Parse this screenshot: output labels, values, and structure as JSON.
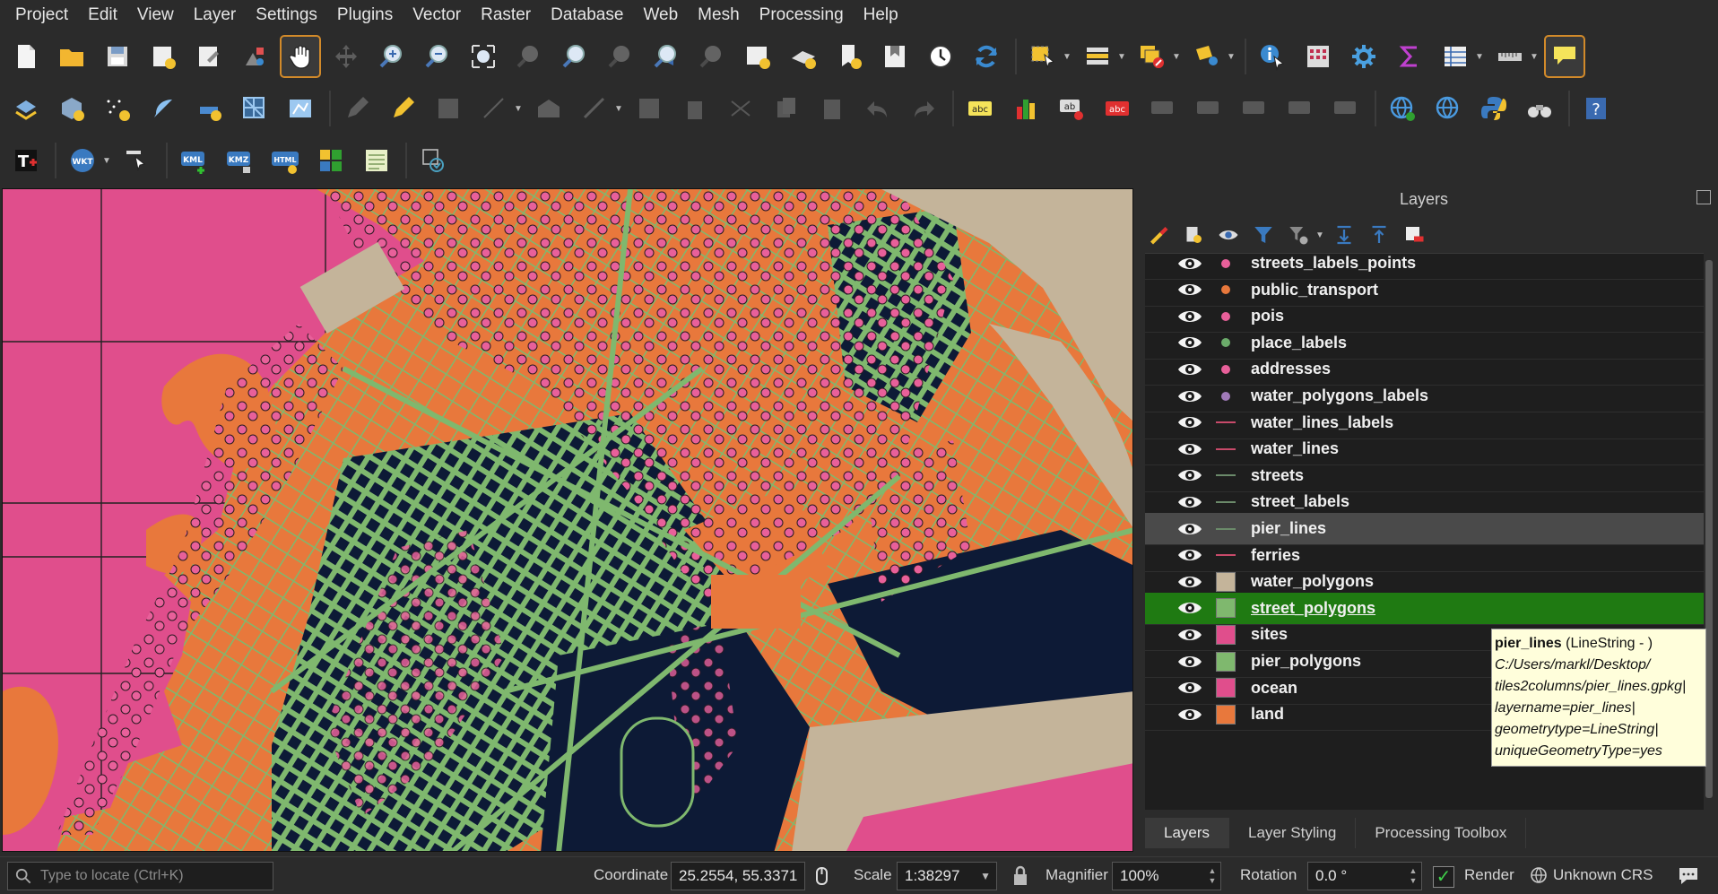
{
  "menubar": {
    "items": [
      "Project",
      "Edit",
      "View",
      "Layer",
      "Settings",
      "Plugins",
      "Vector",
      "Raster",
      "Database",
      "Web",
      "Mesh",
      "Processing",
      "Help"
    ]
  },
  "toolbar": {
    "wkt_label": "WKT",
    "kml_label": "KML",
    "kmz_label": "KMZ",
    "html_label": "HTML",
    "abc_label": "abc",
    "ab_label": "ab"
  },
  "layers_panel": {
    "title": "Layers",
    "layers": [
      {
        "name": "streets_labels_points",
        "type": "point",
        "color": "#e8609a"
      },
      {
        "name": "public_transport",
        "type": "point",
        "color": "#e8783c"
      },
      {
        "name": "pois",
        "type": "point",
        "color": "#e8609a"
      },
      {
        "name": "place_labels",
        "type": "point",
        "color": "#6bab6a"
      },
      {
        "name": "addresses",
        "type": "point",
        "color": "#e8609a"
      },
      {
        "name": "water_polygons_labels",
        "type": "point",
        "color": "#a07ab8"
      },
      {
        "name": "water_lines_labels",
        "type": "line",
        "color": "#c84a6a"
      },
      {
        "name": "water_lines",
        "type": "line",
        "color": "#c84a6a"
      },
      {
        "name": "streets",
        "type": "line",
        "color": "#6b8a6a"
      },
      {
        "name": "street_labels",
        "type": "line",
        "color": "#6b8a6a"
      },
      {
        "name": "pier_lines",
        "type": "line",
        "color": "#6b8a6a",
        "state": "hover"
      },
      {
        "name": "ferries",
        "type": "line",
        "color": "#c84a6a"
      },
      {
        "name": "water_polygons",
        "type": "polygon",
        "color": "#c4b49a"
      },
      {
        "name": "street_polygons",
        "type": "polygon",
        "color": "#7fb86e",
        "state": "selected"
      },
      {
        "name": "sites",
        "type": "polygon",
        "color": "#e04e8c"
      },
      {
        "name": "pier_polygons",
        "type": "polygon",
        "color": "#7fb86e"
      },
      {
        "name": "ocean",
        "type": "polygon",
        "color": "#e04e8c"
      },
      {
        "name": "land",
        "type": "polygon",
        "color": "#e8783c"
      }
    ],
    "tabs": [
      "Layers",
      "Layer Styling",
      "Processing Toolbox"
    ]
  },
  "tooltip": {
    "name": "pier_lines",
    "geom": " (LineString - )",
    "lines": [
      "C:/Users/markl/Desktop/",
      "tiles2columns/pier_lines.gpkg|",
      "layername=pier_lines|",
      "geometrytype=LineString|",
      "uniqueGeometryType=yes"
    ]
  },
  "statusbar": {
    "locator_placeholder": "Type to locate (Ctrl+K)",
    "coordinate_label": "Coordinate",
    "coordinate_value": "25.2554, 55.3371",
    "scale_label": "Scale",
    "scale_value": "1:38297",
    "magnifier_label": "Magnifier",
    "magnifier_value": "100%",
    "rotation_label": "Rotation",
    "rotation_value": "0.0 °",
    "render_label": "Render",
    "crs_label": "Unknown CRS"
  },
  "map_colors": {
    "ocean": "#e04e8c",
    "land": "#e8783c",
    "streets": "#7fb86e",
    "sites": "#0d1a36",
    "water": "#c4b49a",
    "points": "#e8609a"
  }
}
